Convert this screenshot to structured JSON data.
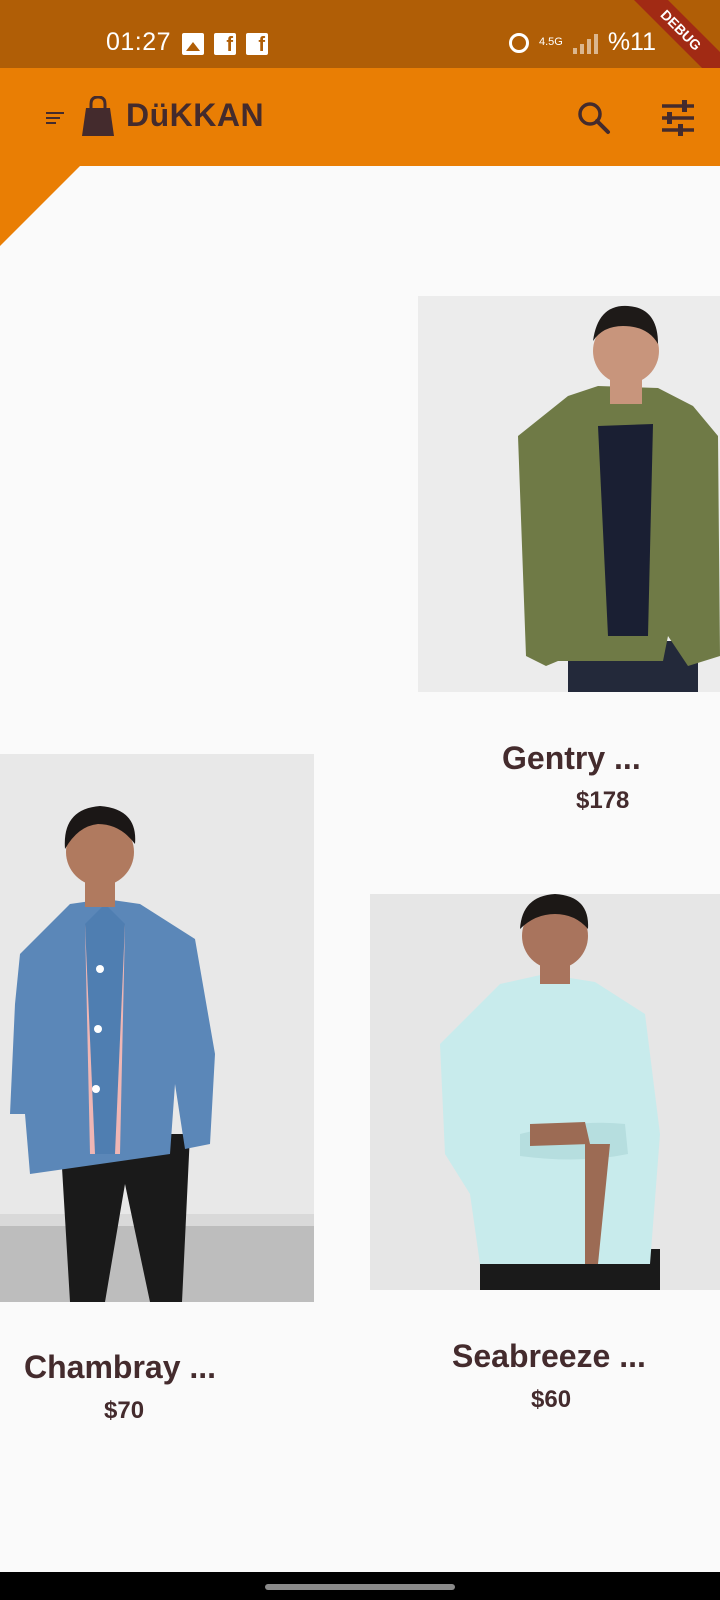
{
  "status_bar": {
    "time": "01:27",
    "network": "4.5G",
    "battery": "%11"
  },
  "debug_banner": "DEBUG",
  "app_bar": {
    "title": "DüKKAN"
  },
  "products": [
    {
      "name": "Gentry ...",
      "price": "$178"
    },
    {
      "name": "Chambray ...",
      "price": "$70"
    },
    {
      "name": "Seabreeze ...",
      "price": "$60"
    }
  ],
  "colors": {
    "status_bar": "#b05e06",
    "primary": "#e97e04",
    "text": "#442b2d",
    "background": "#fafafa"
  },
  "icons": {
    "menu": "menu-icon",
    "brand": "shopping-bag-icon",
    "search": "search-icon",
    "filter": "tune-icon"
  }
}
